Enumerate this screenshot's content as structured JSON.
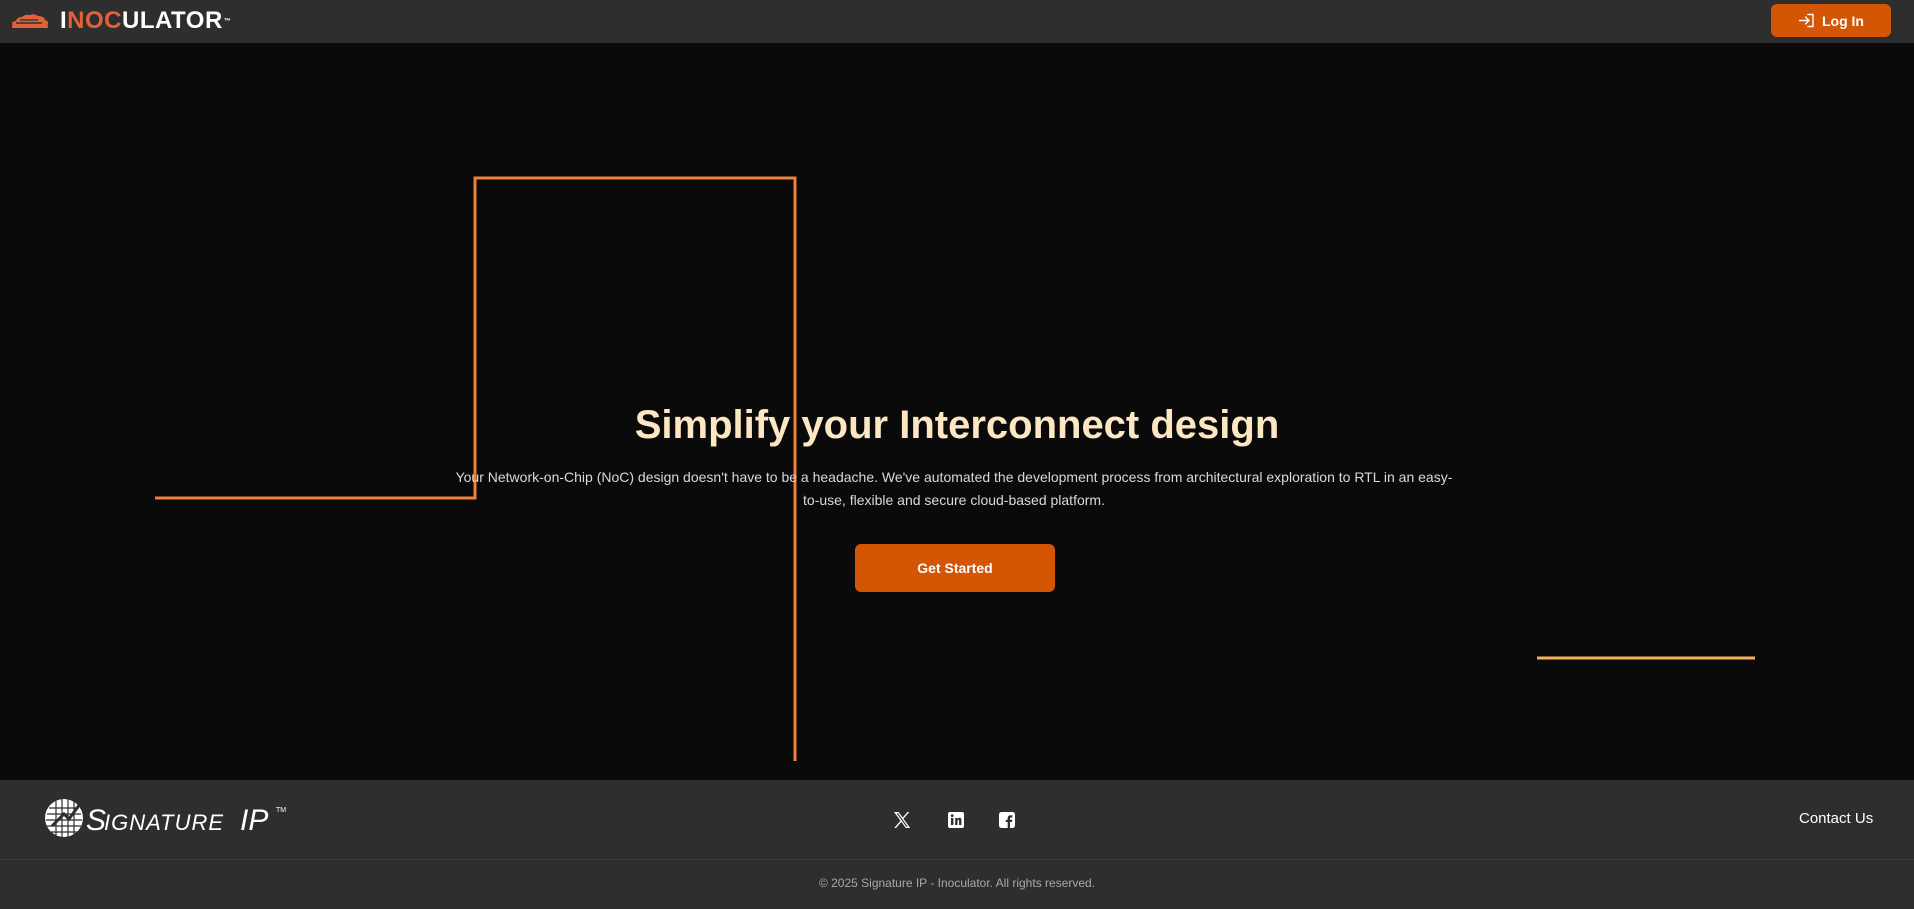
{
  "header": {
    "brand_prefix": "I",
    "brand_accent": "NOC",
    "brand_suffix": "ULATOR",
    "brand_tm": "™",
    "login_label": "Log In",
    "login_icon": "login-icon"
  },
  "hero": {
    "title": "Simplify your Interconnect design",
    "subtitle": "Your Network-on-Chip (NoC) design doesn't have to be a headache. We've automated the development process from architectural exploration to RTL in an easy-to-use, flexible and secure cloud-based platform.",
    "cta_label": "Get Started"
  },
  "footer": {
    "logo_text": "SignatureIP",
    "logo_tm": "™",
    "social": [
      "x-icon",
      "linkedin-icon",
      "facebook-icon"
    ],
    "contact_label": "Contact Us",
    "copyright": "© 2025 Signature IP - Inoculator. All rights reserved."
  },
  "colors": {
    "accent": "#d45504",
    "brand_red": "#e0613a",
    "line_orange": "#f07f3a",
    "line_gold": "#f4b15a",
    "title": "#fde6c2",
    "bar_bg": "#2e2e2e",
    "page_bg": "#0a0a0a"
  }
}
